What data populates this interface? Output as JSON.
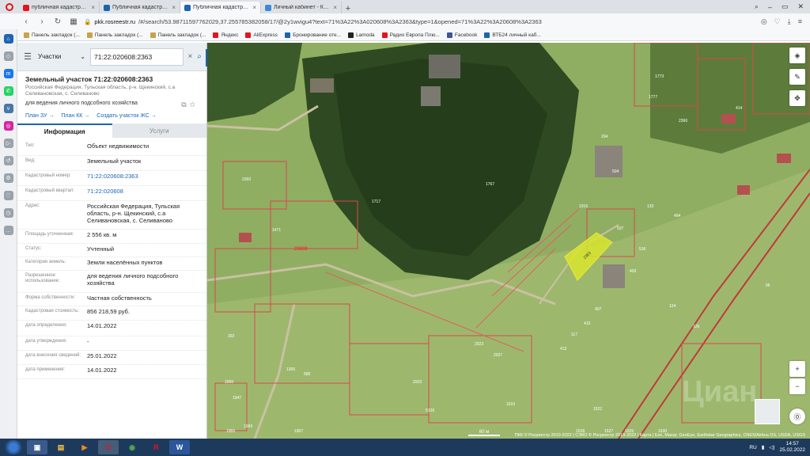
{
  "browser": {
    "tabs": [
      {
        "label": "публичная кадастровая к",
        "color": "#e0161e"
      },
      {
        "label": "Публичная кадастровая к",
        "color": "#1d64b0"
      },
      {
        "label": "Публичная кадастровая к",
        "color": "#1d64b0"
      },
      {
        "label": "Личный кабинет - Кошел",
        "color": "#3b8ad9"
      }
    ],
    "active_tab": 2,
    "url_host": "pkk.rosreestr.ru",
    "url_rest": "/#/search/53.98711597762029,37.255785382058/17/@2y1wvigu4?text=71%3A22%3A020608%3A2363&type=1&opened=71%3A22%3A20608%3A2363",
    "bookmarks": [
      {
        "label": "Панель закладок (...",
        "color": "#c8a34a"
      },
      {
        "label": "Панель закладок (...",
        "color": "#c8a34a"
      },
      {
        "label": "Панель закладок (...",
        "color": "#c8a34a"
      },
      {
        "label": "Яндекс",
        "color": "#e0161e"
      },
      {
        "label": "AliExpress",
        "color": "#e0161e"
      },
      {
        "label": "Бронирование оте...",
        "color": "#1d64b0"
      },
      {
        "label": "Lamoda",
        "color": "#222222"
      },
      {
        "label": "Радио Европа Плю...",
        "color": "#e0161e"
      },
      {
        "label": "Facebook",
        "color": "#3b5998"
      },
      {
        "label": "ВТБ24 личный каб...",
        "color": "#1d64b0"
      }
    ]
  },
  "panel": {
    "search_type": "Участки",
    "search_value": "71:22:020608:2363",
    "title": "Земельный участок 71:22:020608:2363",
    "address_short": "Российская Федерация, Тульская область, р-н. Щекинский, с.а Селивановская, с. Селиваново",
    "purpose": "для ведения личного подсобного хозяйства",
    "links": [
      "План ЗУ →",
      "План КК →",
      "Создать участок ЖС →"
    ],
    "tabs": {
      "info": "Информация",
      "services": "Услуги"
    },
    "rows": [
      {
        "k": "Тип:",
        "v": "Объект недвижимости",
        "link": false
      },
      {
        "k": "Вид:",
        "v": "Земельный участок",
        "link": false
      },
      {
        "k": "Кадастровый номер:",
        "v": "71:22:020608:2363",
        "link": true
      },
      {
        "k": "Кадастровый квартал:",
        "v": "71:22:020608",
        "link": true
      },
      {
        "k": "Адрес:",
        "v": "Российская Федерация, Тульская область, р-н. Щекинский, с.а Селивановская, с. Селиваново",
        "link": false
      },
      {
        "k": "Площадь уточненная:",
        "v": "2 556 кв. м",
        "link": false
      },
      {
        "k": "Статус:",
        "v": "Учтенный",
        "link": false
      },
      {
        "k": "Категория земель:",
        "v": "Земли населённых пунктов",
        "link": false
      },
      {
        "k": "Разрешенное использование:",
        "v": "для ведения личного подсобного хозяйства",
        "link": false
      },
      {
        "k": "Форма собственности:",
        "v": "Частная собственность",
        "link": false
      },
      {
        "k": "Кадастровая стоимость:",
        "v": "856 218,59 руб.",
        "link": false
      },
      {
        "k": "дата определения:",
        "v": "14.01.2022",
        "link": false
      },
      {
        "k": "дата утверждения:",
        "v": "-",
        "link": false
      },
      {
        "k": "дата внесения сведений:",
        "v": "25.01.2022",
        "link": false
      },
      {
        "k": "дата применения:",
        "v": "14.01.2022",
        "link": false
      }
    ]
  },
  "map": {
    "parcel_labels": [
      "1717",
      "1767",
      "1916",
      "2360",
      "1471",
      "20608",
      "392",
      "1365",
      "2023",
      "2027",
      "1510",
      "2003",
      "1957",
      "585",
      "5126",
      "1773",
      "2366",
      "414",
      "494",
      "1777",
      "133",
      "504",
      "294",
      "537",
      "516",
      "407",
      "410",
      "413",
      "124",
      "126",
      "95",
      "403",
      "117",
      "1522",
      "1525",
      "1530",
      "1527",
      "1528",
      "1955",
      "1947",
      "1966",
      "1969"
    ],
    "selected_label": "2363",
    "scale": "60 м",
    "attribution": "ПКК © Росреестр 2010-2022 | СЭКО © Росреестр 2019-2022 | Карта | Esri, Maxar, GeoEye, Earthstar Geographics, CNES/Airbus DS, USDA, USGS",
    "watermark": "Циан"
  },
  "taskbar": {
    "lang": "RU",
    "time": "14:57",
    "date": "25.02.2022"
  }
}
